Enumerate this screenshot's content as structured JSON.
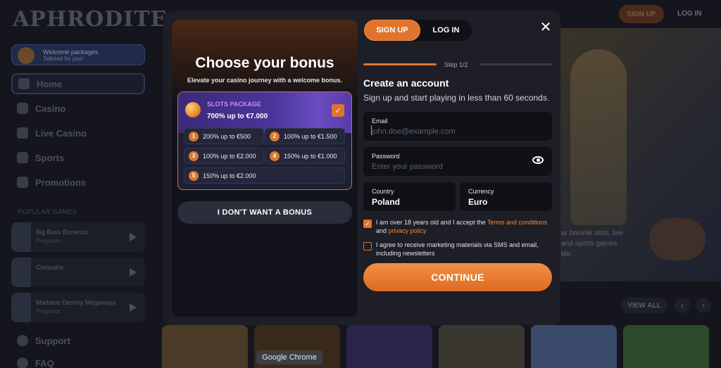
{
  "background": {
    "logo": "APHRODITE",
    "promo": {
      "title": "Welcome packages",
      "subtitle": "Tailored for you!"
    },
    "menu": [
      {
        "label": "Home",
        "icon": "home-icon"
      },
      {
        "label": "Casino",
        "icon": "casino-chip-icon"
      },
      {
        "label": "Live Casino",
        "icon": "dice-icon"
      },
      {
        "label": "Sports",
        "icon": "ball-icon"
      },
      {
        "label": "Promotions",
        "icon": "gift-icon"
      }
    ],
    "popular_heading": "POPULAR GAMES",
    "games": [
      {
        "name": "Big Bass Bonanza",
        "provider": "Pragmatic"
      },
      {
        "name": "Cleopatra",
        "provider": ""
      },
      {
        "name": "Madame Destiny Megaways",
        "provider": "Pragmatic"
      }
    ],
    "bottom_menu": [
      {
        "label": "Support",
        "icon": "support-icon"
      },
      {
        "label": "FAQ",
        "icon": "faq-icon"
      }
    ],
    "top_signup": "SIGN UP",
    "top_login": "LOG IN",
    "hero_text_lines": [
      "ur favorite slots, live",
      "and sports games",
      "ble."
    ],
    "view_all": "VIEW ALL",
    "prev_arrow": "‹",
    "next_arrow": "›"
  },
  "tooltip": "Google Chrome",
  "modal": {
    "bonus": {
      "title": "Choose your bonus",
      "subtitle": "Elevate your casino journey with a welcome bonus.",
      "package_name": "SLOTS PACKAGE",
      "package_amount": "700% up to €7.000",
      "package_selected": true,
      "offers": [
        {
          "num": "1",
          "text": "200% up to €500"
        },
        {
          "num": "2",
          "text": "100% up to €1.500"
        },
        {
          "num": "3",
          "text": "100% up to €2.000"
        },
        {
          "num": "4",
          "text": "150% up to €1.000"
        },
        {
          "num": "5",
          "text": "150% up to €2.000"
        }
      ],
      "no_bonus": "I DON'T WANT A BONUS"
    },
    "form": {
      "tab_signup": "SIGN UP",
      "tab_login": "LOG IN",
      "close": "✕",
      "step": "Step 1/2",
      "title": "Create an account",
      "subtitle": "Sign up and start playing in less than 60 seconds.",
      "email_label": "Email",
      "email_placeholder": "john.doe@example.com",
      "email_value": "",
      "password_label": "Password",
      "password_placeholder": "Enter your password",
      "password_value": "",
      "country_label": "Country",
      "country_value": "Poland",
      "currency_label": "Currency",
      "currency_value": "Euro",
      "terms_checked": true,
      "terms_prefix": "I am over 18 years old and I accept the ",
      "terms_link": "Terms and conditions",
      "terms_middle": " and ",
      "privacy_link": "privacy policy",
      "marketing_checked": false,
      "marketing_text": "I agree to receive marketing materials via SMS and email, including newsletters",
      "continue": "CONTINUE"
    }
  },
  "colors": {
    "accent": "#e0742e",
    "modal_bg": "#1d1e26",
    "field_bg": "#101117"
  }
}
